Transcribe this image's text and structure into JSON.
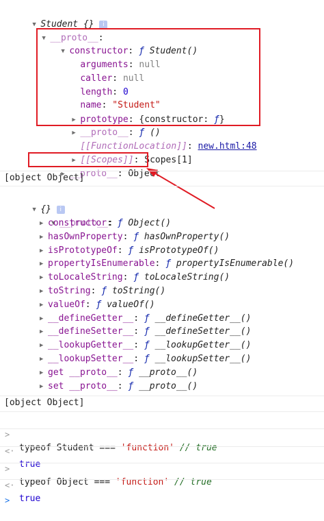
{
  "tree1": {
    "root": "Student",
    "root_braces": "{}",
    "proto1": "__proto__",
    "constructor_key": "constructor",
    "constructor_fn": "Student()",
    "arguments_key": "arguments",
    "arguments_val": "null",
    "caller_key": "caller",
    "caller_val": "null",
    "length_key": "length",
    "length_val": "0",
    "name_key": "name",
    "name_val": "\"Student\"",
    "prototype_key": "prototype",
    "prototype_val": "{constructor: ",
    "prototype_f": "ƒ",
    "prototype_close": "}",
    "inner_proto_key": "__proto__",
    "inner_proto_val": "()",
    "fnloc_key": "[[FunctionLocation]]",
    "fnloc_val": "new.html:48",
    "scopes_key": "[[Scopes]]",
    "scopes_val": "Scopes[1]",
    "proto2_key": "__proto__",
    "proto2_val": "Object",
    "f_glyph": "ƒ"
  },
  "log1": "[object Object]",
  "tree2": {
    "root": "{}",
    "proto": "__proto__",
    "items": [
      {
        "key": "constructor",
        "val": "Object()"
      },
      {
        "key": "hasOwnProperty",
        "val": "hasOwnProperty()"
      },
      {
        "key": "isPrototypeOf",
        "val": "isPrototypeOf()"
      },
      {
        "key": "propertyIsEnumerable",
        "val": "propertyIsEnumerable()"
      },
      {
        "key": "toLocaleString",
        "val": "toLocaleString()"
      },
      {
        "key": "toString",
        "val": "toString()"
      },
      {
        "key": "valueOf",
        "val": "valueOf()"
      },
      {
        "key": "__defineGetter__",
        "val": "__defineGetter__()"
      },
      {
        "key": "__defineSetter__",
        "val": "__defineSetter__()"
      },
      {
        "key": "__lookupGetter__",
        "val": "__lookupGetter__()"
      },
      {
        "key": "__lookupSetter__",
        "val": "__lookupSetter__()"
      },
      {
        "key": "get __proto__",
        "val": "__proto__()"
      },
      {
        "key": "set __proto__",
        "val": "__proto__()"
      }
    ]
  },
  "log2": "[object Object]",
  "cmd1": {
    "lhs": "typeof",
    "name": "Student",
    "op": "===",
    "str": "'function'",
    "comment": "// true"
  },
  "res1": "true",
  "cmd2": {
    "lhs": "typeof",
    "name": "Object",
    "op": "===",
    "str": "'function'",
    "comment": "// true"
  },
  "res2": "true",
  "prompt_glyph": ">",
  "result_glyph": "<·",
  "colors": {
    "highlight": "#e01b24",
    "property": "#881391",
    "string": "#c41a16",
    "number": "#1c00cf",
    "link": "#1a1aa6"
  }
}
